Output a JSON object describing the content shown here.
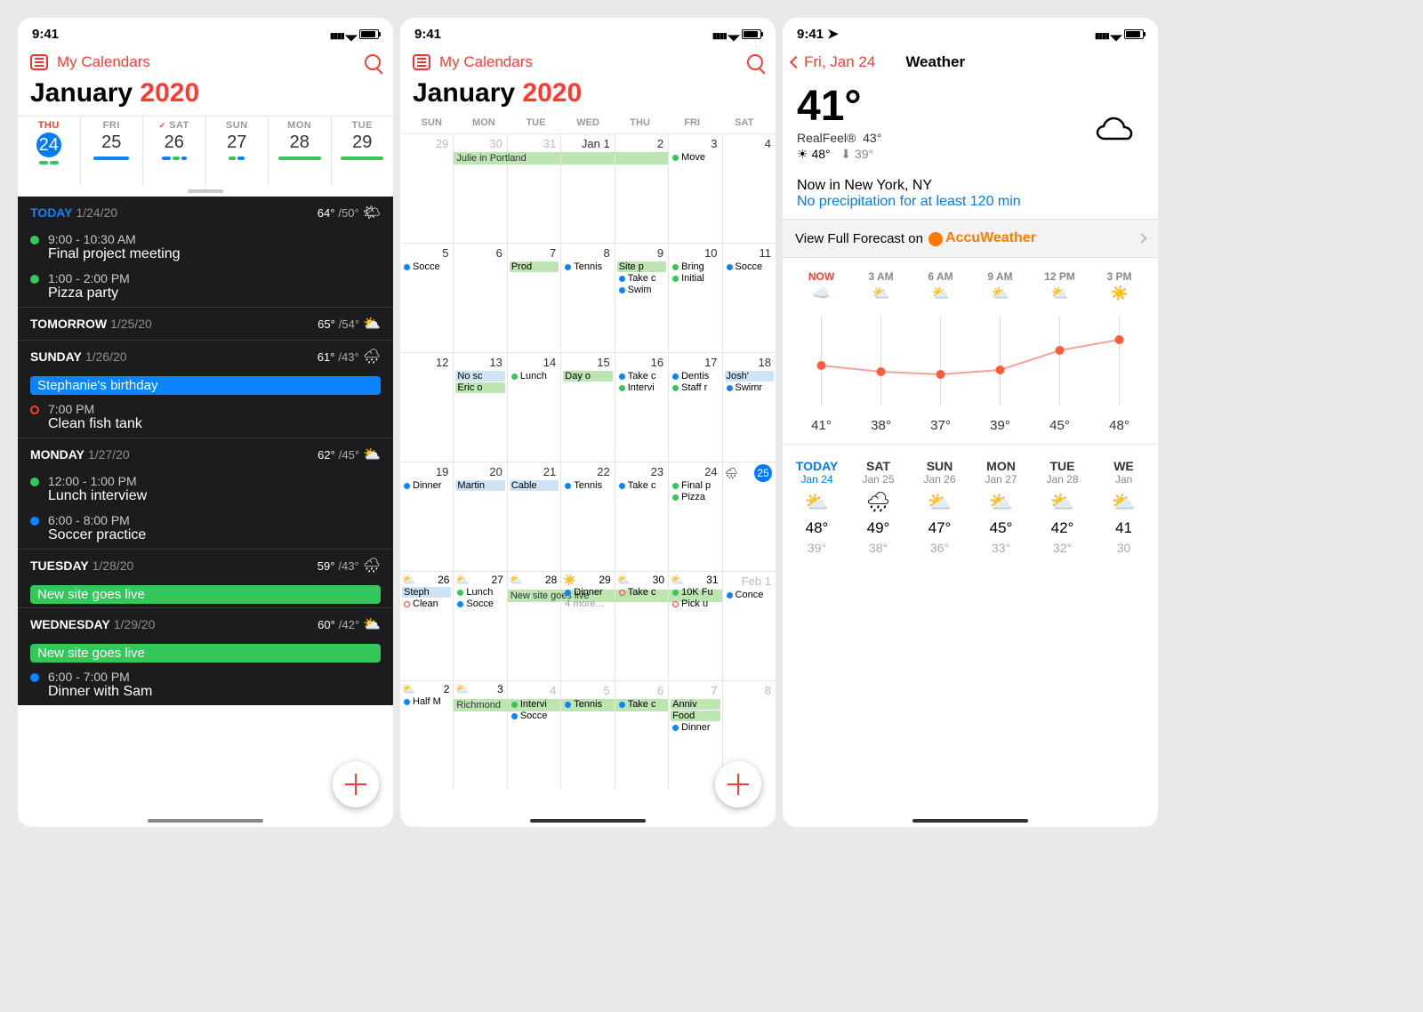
{
  "status": {
    "time": "9:41"
  },
  "topbar": {
    "my_calendars": "My Calendars"
  },
  "month_title": {
    "month": "January",
    "year": "2020"
  },
  "panelA": {
    "weekstrip": [
      {
        "label": "THU",
        "num": "24",
        "today": true
      },
      {
        "label": "FRI",
        "num": "25"
      },
      {
        "label": "SAT",
        "num": "26",
        "check": true
      },
      {
        "label": "SUN",
        "num": "27"
      },
      {
        "label": "MON",
        "num": "28"
      },
      {
        "label": "TUE",
        "num": "29"
      }
    ],
    "days": [
      {
        "label": "TODAY",
        "date": "1/24/20",
        "today": true,
        "hi": "64°",
        "lo": "/50°",
        "icon": "🌤",
        "items": [
          {
            "dot": "#34c759",
            "time": "9:00 - 10:30 AM",
            "title": "Final project meeting"
          },
          {
            "dot": "#34c759",
            "time": "1:00 - 2:00 PM",
            "title": "Pizza party"
          }
        ]
      },
      {
        "label": "TOMORROW",
        "date": "1/25/20",
        "hi": "65°",
        "lo": "/54°",
        "icon": "⛅",
        "items": []
      },
      {
        "label": "SUNDAY",
        "date": "1/26/20",
        "hi": "61°",
        "lo": "/43°",
        "icon": "🌧",
        "pill": {
          "text": "Stephanie's birthday",
          "color": "#0a84ff"
        },
        "items": [
          {
            "dot": "#ff3b30",
            "ring": true,
            "time": "7:00 PM",
            "title": "Clean fish tank"
          }
        ]
      },
      {
        "label": "MONDAY",
        "date": "1/27/20",
        "hi": "62°",
        "lo": "/45°",
        "icon": "⛅",
        "items": [
          {
            "dot": "#34c759",
            "time": "12:00 - 1:00 PM",
            "title": "Lunch interview"
          },
          {
            "dot": "#0a84ff",
            "time": "6:00 - 8:00 PM",
            "title": "Soccer practice"
          }
        ]
      },
      {
        "label": "TUESDAY",
        "date": "1/28/20",
        "hi": "59°",
        "lo": "/43°",
        "icon": "🌧",
        "pill": {
          "text": "New site goes live",
          "color": "#34c759"
        },
        "items": []
      },
      {
        "label": "WEDNESDAY",
        "date": "1/29/20",
        "hi": "60°",
        "lo": "/42°",
        "icon": "⛅",
        "pill": {
          "text": "New site goes live",
          "color": "#34c759"
        },
        "items": [
          {
            "dot": "#0a84ff",
            "time": "6:00 - 7:00 PM",
            "title": "Dinner with Sam"
          }
        ]
      }
    ]
  },
  "panelB": {
    "dow": [
      "SUN",
      "MON",
      "TUE",
      "WED",
      "THU",
      "FRI",
      "SAT"
    ],
    "weeks": [
      [
        {
          "n": "29",
          "out": true
        },
        {
          "n": "30",
          "out": true
        },
        {
          "n": "31",
          "out": true
        },
        {
          "n": "Jan 1"
        },
        {
          "n": "2"
        },
        {
          "n": "3",
          "ev": [
            {
              "c": "#34c759",
              "t": "Move"
            }
          ]
        },
        {
          "n": "4"
        }
      ],
      [
        {
          "n": "5",
          "ev": [
            {
              "c": "#0a84ff",
              "t": "Socce"
            }
          ]
        },
        {
          "n": "6"
        },
        {
          "n": "7",
          "ev": [
            {
              "bg": "#bce5b1",
              "t": "Prod"
            }
          ]
        },
        {
          "n": "8",
          "ev": [
            {
              "c": "#0a84ff",
              "t": "Tennis"
            }
          ]
        },
        {
          "n": "9",
          "ev": [
            {
              "bg": "#bce5b1",
              "t": "Site p"
            },
            {
              "c": "#0a84ff",
              "t": "Take c"
            },
            {
              "c": "#0a84ff",
              "t": "Swim"
            }
          ]
        },
        {
          "n": "10",
          "ev": [
            {
              "c": "#34c759",
              "t": "Bring"
            },
            {
              "c": "#34c759",
              "t": "Initial"
            }
          ]
        },
        {
          "n": "11",
          "ev": [
            {
              "c": "#0a84ff",
              "t": "Socce"
            }
          ]
        }
      ],
      [
        {
          "n": "12"
        },
        {
          "n": "13",
          "ev": [
            {
              "bg": "#cde4f7",
              "t": "No sc"
            },
            {
              "bg": "#bce5b1",
              "t": "Eric o"
            }
          ]
        },
        {
          "n": "14",
          "ev": [
            {
              "c": "#34c759",
              "t": "Lunch"
            }
          ]
        },
        {
          "n": "15",
          "ev": [
            {
              "bg": "#bce5b1",
              "t": "Day o"
            }
          ]
        },
        {
          "n": "16",
          "ev": [
            {
              "c": "#0a84ff",
              "t": "Take c"
            },
            {
              "c": "#34c759",
              "t": "Intervi"
            }
          ]
        },
        {
          "n": "17",
          "ev": [
            {
              "c": "#0a84ff",
              "t": "Dentis"
            },
            {
              "c": "#34c759",
              "t": "Staff r"
            }
          ]
        },
        {
          "n": "18",
          "ev": [
            {
              "bg": "#cde4f7",
              "t": "Josh'"
            },
            {
              "c": "#0a84ff",
              "t": "Swimr"
            }
          ]
        }
      ],
      [
        {
          "n": "19",
          "ev": [
            {
              "c": "#0a84ff",
              "t": "Dinner"
            }
          ]
        },
        {
          "n": "20",
          "ev": [
            {
              "bg": "#cde4f7",
              "t": "Martin"
            }
          ]
        },
        {
          "n": "21",
          "ev": [
            {
              "bg": "#cde4f7",
              "t": "Cable"
            }
          ]
        },
        {
          "n": "22",
          "ev": [
            {
              "c": "#0a84ff",
              "t": "Tennis"
            }
          ]
        },
        {
          "n": "23",
          "ev": [
            {
              "c": "#0a84ff",
              "t": "Take c"
            }
          ]
        },
        {
          "n": "24",
          "ev": [
            {
              "c": "#34c759",
              "t": "Final p"
            },
            {
              "c": "#34c759",
              "t": "Pizza"
            }
          ]
        },
        {
          "n": "25",
          "today": true,
          "wx": "🌧"
        }
      ],
      [
        {
          "n": "26",
          "wx": "⛅",
          "ev": [
            {
              "bg": "#cde4f7",
              "t": "Steph"
            },
            {
              "r": "#ff3b30",
              "t": "Clean"
            }
          ]
        },
        {
          "n": "27",
          "wx": "⛅",
          "ev": [
            {
              "c": "#34c759",
              "t": "Lunch"
            },
            {
              "c": "#0a84ff",
              "t": "Socce"
            }
          ]
        },
        {
          "n": "28",
          "wx": "⛅",
          "span_start": "New site goes live"
        },
        {
          "n": "29",
          "wx": "☀️",
          "ev": [
            {
              "c": "#0a84ff",
              "t": "Dinner"
            },
            {
              "more": "4 more..."
            }
          ]
        },
        {
          "n": "30",
          "wx": "⛅",
          "ev": [
            {
              "r": "#ff3b30",
              "t": "Take c"
            }
          ]
        },
        {
          "n": "31",
          "wx": "⛅",
          "ev": [
            {
              "c": "#34c759",
              "t": "10K Fu"
            },
            {
              "r": "#ff3b30",
              "t": "Pick u"
            }
          ]
        },
        {
          "n": "Feb 1",
          "out": true,
          "ev": [
            {
              "c": "#0a84ff",
              "t": "Conce"
            }
          ]
        }
      ],
      [
        {
          "n": "2",
          "out": true,
          "wx": "⛅",
          "ev": [
            {
              "c": "#0a84ff",
              "t": "Half M"
            }
          ]
        },
        {
          "n": "3",
          "out": true,
          "wx": "⛅",
          "span_start": "Richmond"
        },
        {
          "n": "4",
          "out": true,
          "ev": [
            {
              "c": "#34c759",
              "t": "Intervi"
            },
            {
              "c": "#0a84ff",
              "t": "Socce"
            }
          ]
        },
        {
          "n": "5",
          "out": true,
          "ev": [
            {
              "c": "#0a84ff",
              "t": "Tennis"
            }
          ]
        },
        {
          "n": "6",
          "out": true,
          "ev": [
            {
              "c": "#0a84ff",
              "t": "Take c"
            }
          ]
        },
        {
          "n": "7",
          "out": true,
          "ev": [
            {
              "bg": "#bce5b1",
              "t": "Anniv"
            },
            {
              "bg": "#bce5b1",
              "t": "Food"
            },
            {
              "c": "#0a84ff",
              "t": "Dinner"
            }
          ]
        },
        {
          "n": "8",
          "out": true
        }
      ]
    ]
  },
  "panelC": {
    "back_date": "Fri, Jan 24",
    "title": "Weather",
    "temp": "41°",
    "realfeel_label": "RealFeel®",
    "realfeel_val": "43°",
    "hi": "48°",
    "lo": "39°",
    "nowin": "Now in New York, NY",
    "noprecip": "No precipitation for at least 120 min",
    "accu_label": "View Full Forecast on",
    "accu_brand": "AccuWeather",
    "hourly": [
      {
        "h": "NOW",
        "t": "41°",
        "i": "☁️",
        "y": 65
      },
      {
        "h": "3 AM",
        "t": "38°",
        "i": "⛅",
        "y": 72
      },
      {
        "h": "6 AM",
        "t": "37°",
        "i": "⛅",
        "y": 75
      },
      {
        "h": "9 AM",
        "t": "39°",
        "i": "⛅",
        "y": 70
      },
      {
        "h": "12 PM",
        "t": "45°",
        "i": "⛅",
        "y": 48
      },
      {
        "h": "3 PM",
        "t": "48°",
        "i": "☀️",
        "y": 36
      }
    ],
    "daily": [
      {
        "d": "TODAY",
        "sub": "Jan 24",
        "i": "⛅",
        "hi": "48°",
        "lo": "39°",
        "today": true
      },
      {
        "d": "SAT",
        "sub": "Jan 25",
        "i": "🌧",
        "hi": "49°",
        "lo": "38°"
      },
      {
        "d": "SUN",
        "sub": "Jan 26",
        "i": "⛅",
        "hi": "47°",
        "lo": "36°"
      },
      {
        "d": "MON",
        "sub": "Jan 27",
        "i": "⛅",
        "hi": "45°",
        "lo": "33°"
      },
      {
        "d": "TUE",
        "sub": "Jan 28",
        "i": "⛅",
        "hi": "42°",
        "lo": "32°"
      },
      {
        "d": "WE",
        "sub": "Jan",
        "i": "⛅",
        "hi": "41",
        "lo": "30"
      }
    ]
  }
}
